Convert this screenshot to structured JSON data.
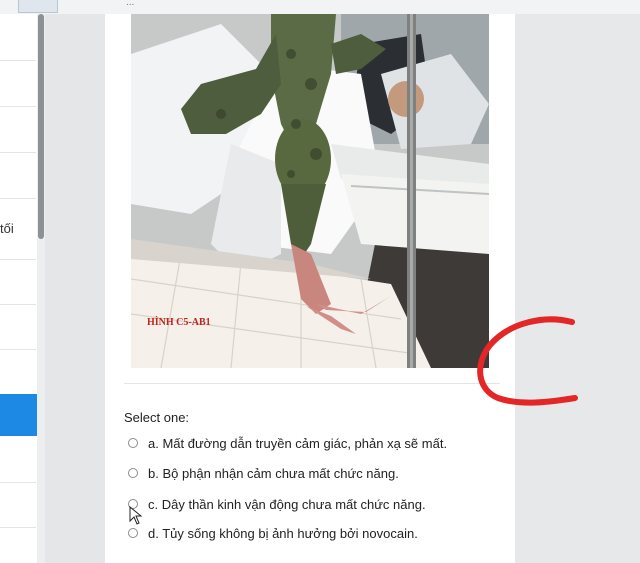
{
  "topbar": {
    "fragment": "..."
  },
  "sidebar": {
    "fragment_text": "tối"
  },
  "figure": {
    "caption": "HÌNH C5-AB1"
  },
  "question": {
    "prompt": "Select one:",
    "options": [
      {
        "label": "a. Mất đường dẫn truyền cảm giác, phản xạ sẽ mất."
      },
      {
        "label": "b. Bộ phận nhận cảm chưa mất chức năng."
      },
      {
        "label": "c. Dây thần kinh vận động chưa mất chức năng."
      },
      {
        "label": "d. Tủy sống không bị ảnh hưởng bởi novocain."
      }
    ]
  },
  "colors": {
    "accent": "#1e88e5",
    "annotation": "#e32626"
  },
  "icons": [
    "mouse-cursor-icon",
    "radio-icon"
  ]
}
